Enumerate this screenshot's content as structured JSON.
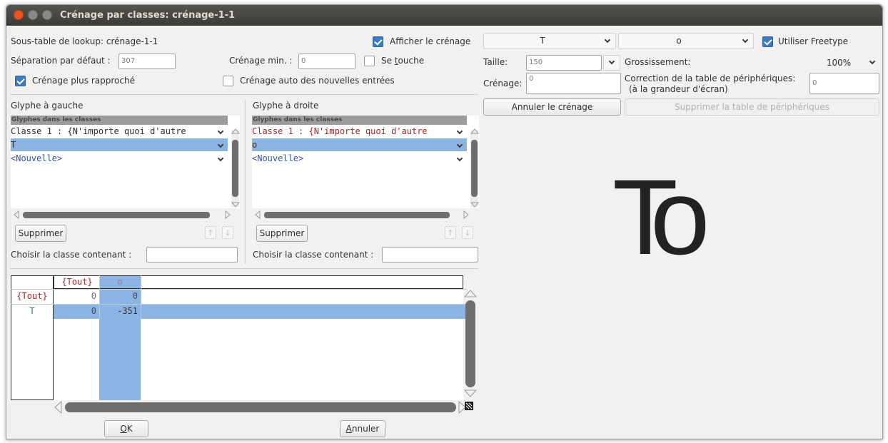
{
  "window": {
    "title": "Crénage par classes: crénage-1-1"
  },
  "top": {
    "lookup_label": "Sous-table de lookup: crénage-1-1",
    "show_kerning_label": "Afficher le crénage",
    "show_kerning_checked": true,
    "default_sep_label": "Séparation par défaut :",
    "default_sep_value": "307",
    "min_kern_label": "Crénage min. :",
    "min_kern_value": "0",
    "touch_label_pre": "Se ",
    "touch_label_u": "t",
    "touch_label_post": "ouche",
    "touch_checked": false,
    "closer_label": "Crénage plus rapproché",
    "closer_checked": true,
    "auto_kern_label": "Crénage auto des nouvelles entrées",
    "auto_kern_checked": false
  },
  "left_panel": {
    "heading": "Glyphe à gauche",
    "list_header": "Glyphes dans les classes",
    "rows": [
      "Classe 1 : {N'importe quoi d'autre",
      "T",
      "<Nouvelle>"
    ],
    "delete_button": "Supprimer",
    "up_icon": "↑",
    "down_icon": "↓",
    "choose_label": "Choisir la classe contenant :",
    "choose_value": ""
  },
  "right_panel": {
    "heading": "Glyphe à droite",
    "list_header": "Glyphes dans les classes",
    "rows": [
      "Classe 1 : {N'importe quoi d'autre",
      "o",
      "<Nouvelle>"
    ],
    "delete_button": "Supprimer",
    "up_icon": "↑",
    "down_icon": "↓",
    "choose_label": "Choisir la classe contenant :",
    "choose_value": ""
  },
  "matrix": {
    "col_headers": [
      "{Tout}",
      "o"
    ],
    "row_headers": [
      "{Tout}",
      "T"
    ],
    "cells": [
      [
        "0",
        "0"
      ],
      [
        "0",
        "-351"
      ]
    ]
  },
  "buttons": {
    "ok_u": "O",
    "ok_rest": "K",
    "cancel_u": "A",
    "cancel_rest": "nnuler"
  },
  "preview": {
    "left_glyph": "T",
    "right_glyph": "o",
    "freetype_label": "Utiliser Freetype",
    "freetype_checked": true,
    "size_label": "Taille:",
    "size_value": "150",
    "zoom_label": "Grossissement:",
    "zoom_value": "100%",
    "kern_label": "Crénage:",
    "kern_value": "0",
    "device_label_1": "Correction de la table de périphériques:",
    "device_label_2": "(à la grandeur d'écran)",
    "device_value": "0",
    "reset_button": "Annuler le crénage",
    "delete_device_button": "Supprimer la table de périphériques",
    "sample_text": "To"
  },
  "colors": {
    "selection": "#8cb4e2",
    "class_text": "#a4262c",
    "accent": "#3d7bc1",
    "close_button": "#e9541f"
  }
}
